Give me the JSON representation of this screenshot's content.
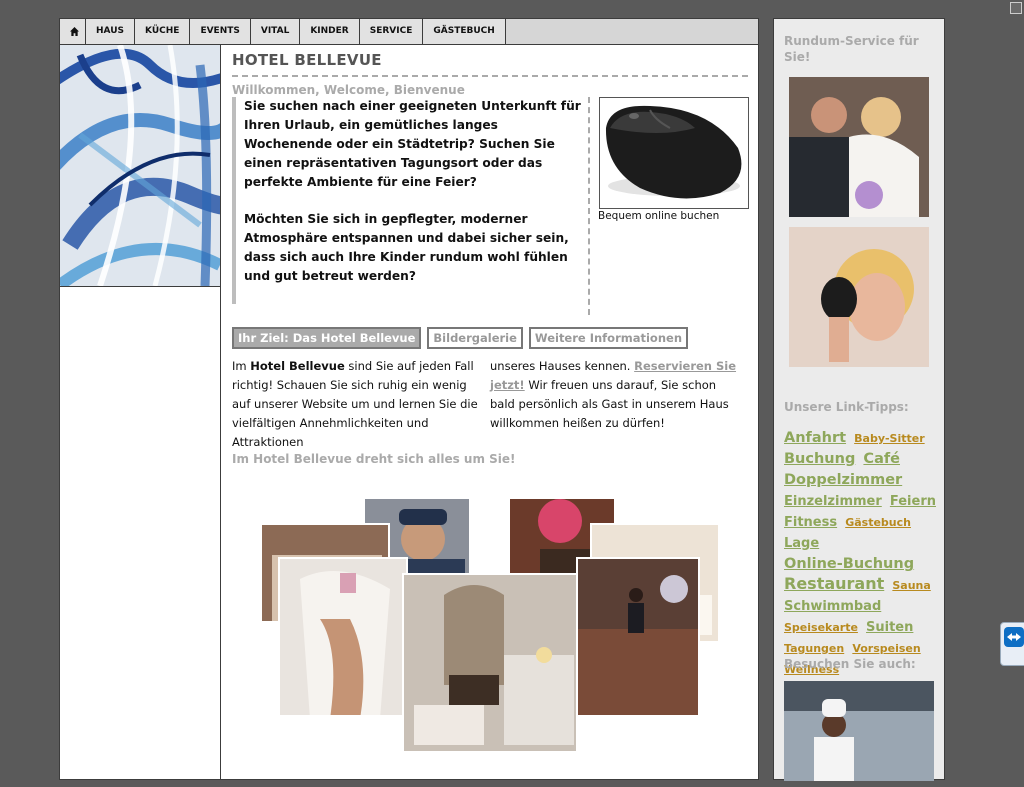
{
  "nav": {
    "home_icon": "home-icon",
    "items": [
      "HAUS",
      "KÜCHE",
      "EVENTS",
      "VITAL",
      "KINDER",
      "SERVICE",
      "GÄSTEBUCH"
    ]
  },
  "main": {
    "title": "HOTEL BELLEVUE",
    "subtitle": "Willkommen, Welcome, Bienvenue",
    "intro_p1": "Sie suchen nach einer geeigneten Unterkunft für Ihren Urlaub, ein gemütliches langes Wochenende oder ein Städtetrip? Suchen Sie einen repräsentativen Tagungsort oder das perfekte Ambiente für eine Feier?",
    "intro_p2": "Möchten Sie sich in gepflegter, moderner Atmosphäre entspannen und dabei sicher sein, dass sich auch Ihre Kinder rundum wohl fühlen und gut betreut werden?",
    "mouse_caption": "Bequem online buchen",
    "tabs": [
      "Ihr Ziel: Das Hotel Bellevue",
      "Bildergalerie",
      "Weitere Informationen"
    ],
    "col1_pre": "Im ",
    "col1_strong": "Hotel Bellevue",
    "col1_post": " sind Sie auf jeden Fall richtig! Schauen Sie sich ruhig ein wenig auf unserer Website um und lernen Sie die vielfältigen Annehmlichkeiten und Attraktionen",
    "col2_pre": "unseres Hauses kennen. ",
    "col2_link": "Reservieren Sie jetzt!",
    "col2_post": " Wir freuen uns darauf, Sie schon bald persönlich als Gast in unserem Haus willkommen heißen zu dürfen!",
    "tagline": "Im Hotel Bellevue dreht sich alles um Sie!"
  },
  "sidebar": {
    "service_heading": "Rundum-Service für Sie!",
    "links_heading": "Unsere Link-Tipps:",
    "tags": [
      {
        "label": "Anfahrt",
        "size": "l"
      },
      {
        "label": "Baby-Sitter",
        "size": "s"
      },
      {
        "label": "Buchung",
        "size": "l"
      },
      {
        "label": "Café",
        "size": "l"
      },
      {
        "label": "Doppelzimmer",
        "size": "l"
      },
      {
        "label": "Einzelzimmer",
        "size": "m"
      },
      {
        "label": "Feiern",
        "size": "m"
      },
      {
        "label": "Fitness",
        "size": "m"
      },
      {
        "label": "Gästebuch",
        "size": "s"
      },
      {
        "label": "Lage",
        "size": "m"
      },
      {
        "label": "Online-Buchung",
        "size": "l"
      },
      {
        "label": "Restaurant",
        "size": "xl"
      },
      {
        "label": "Sauna",
        "size": "s"
      },
      {
        "label": "Schwimmbad",
        "size": "m"
      },
      {
        "label": "Speisekarte",
        "size": "s"
      },
      {
        "label": "Suiten",
        "size": "m"
      },
      {
        "label": "Tagungen",
        "size": "s"
      },
      {
        "label": "Vorspeisen",
        "size": "s"
      },
      {
        "label": "Wellness",
        "size": "s"
      }
    ],
    "visit_heading": "Besuchen Sie auch:"
  }
}
